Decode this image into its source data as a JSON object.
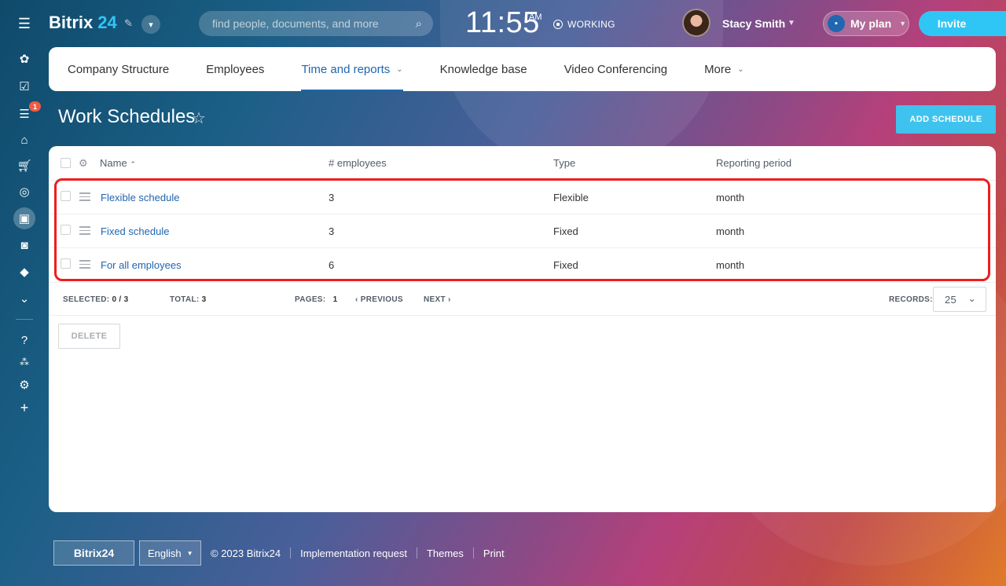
{
  "app": {
    "logo_word": "Bitrix",
    "logo_num": "24"
  },
  "search": {
    "placeholder": "find people, documents, and more"
  },
  "clock": {
    "time": "11:55",
    "ampm": "AM",
    "status": "WORKING"
  },
  "user": {
    "name": "Stacy Smith"
  },
  "plan": {
    "label": "My plan"
  },
  "invite": {
    "label": "Invite"
  },
  "sidebar": {
    "badge": "1"
  },
  "tabs": [
    {
      "label": "Company Structure"
    },
    {
      "label": "Employees"
    },
    {
      "label": "Time and reports"
    },
    {
      "label": "Knowledge base"
    },
    {
      "label": "Video Conferencing"
    },
    {
      "label": "More"
    }
  ],
  "page": {
    "title": "Work Schedules",
    "add_button": "ADD SCHEDULE"
  },
  "grid": {
    "columns": [
      "Name",
      "# employees",
      "Type",
      "Reporting period"
    ],
    "rows": [
      {
        "name": "Flexible schedule",
        "employees": "3",
        "type": "Flexible",
        "period": "month"
      },
      {
        "name": "Fixed schedule",
        "employees": "3",
        "type": "Fixed",
        "period": "month"
      },
      {
        "name": "For all employees",
        "employees": "6",
        "type": "Fixed",
        "period": "month"
      }
    ],
    "footer": {
      "selected_label": "SELECTED:",
      "selected_value": "0 / 3",
      "total_label": "TOTAL:",
      "total_value": "3",
      "pages_label": "PAGES:",
      "pages_value": "1",
      "previous": "PREVIOUS",
      "next": "NEXT",
      "records_label": "RECORDS:",
      "records_value": "25"
    },
    "delete_button": "DELETE"
  },
  "footer": {
    "logo": "Bitrix24",
    "language": "English",
    "copyright": "© 2023 Bitrix24",
    "links": [
      "Implementation request",
      "Themes",
      "Print"
    ]
  },
  "colors": {
    "accent": "#2fc6f6",
    "link": "#2066b0",
    "highlight": "#ef1d1d"
  }
}
